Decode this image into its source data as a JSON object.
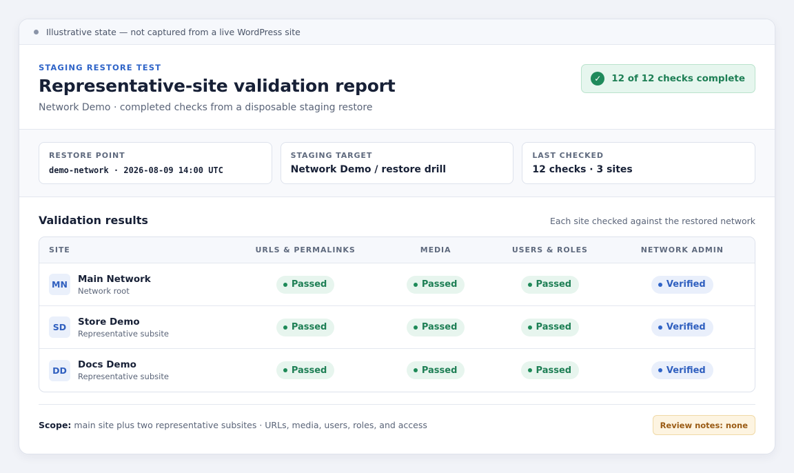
{
  "notice": "Illustrative state — not captured from a live WordPress site",
  "header": {
    "eyebrow": "STAGING RESTORE TEST",
    "title": "Representative-site validation report",
    "subtitle": "Network Demo · completed checks from a disposable staging restore",
    "complete_badge": "12 of 12 checks complete",
    "complete_icon": "check-circle-icon"
  },
  "meta": [
    {
      "label": "RESTORE POINT",
      "value": "demo-network · 2026-08-09 14:00 UTC"
    },
    {
      "label": "STAGING TARGET",
      "value": "Network Demo / restore drill"
    },
    {
      "label": "LAST CHECKED",
      "value": "12 checks · 3 sites"
    }
  ],
  "results": {
    "title": "Validation results",
    "note": "Each site checked against the restored network",
    "columns": [
      "SITE",
      "URLS & PERMALINKS",
      "MEDIA",
      "USERS & ROLES",
      "NETWORK ADMIN"
    ],
    "rows": [
      {
        "initials": "MN",
        "name": "Main Network",
        "sub": "Network root",
        "urls": "Passed",
        "media": "Passed",
        "users": "Passed",
        "admin": "Verified"
      },
      {
        "initials": "SD",
        "name": "Store Demo",
        "sub": "Representative subsite",
        "urls": "Passed",
        "media": "Passed",
        "users": "Passed",
        "admin": "Verified"
      },
      {
        "initials": "DD",
        "name": "Docs Demo",
        "sub": "Representative subsite",
        "urls": "Passed",
        "media": "Passed",
        "users": "Passed",
        "admin": "Verified"
      }
    ]
  },
  "footer": {
    "scope_label": "Scope:",
    "scope_text": "main site plus two representative subsites · URLs, media, users, roles, and access",
    "review": "Review notes: none"
  },
  "colors": {
    "accent": "#2f64c8",
    "success": "#1e7f55",
    "warning": "#9a5b14"
  }
}
